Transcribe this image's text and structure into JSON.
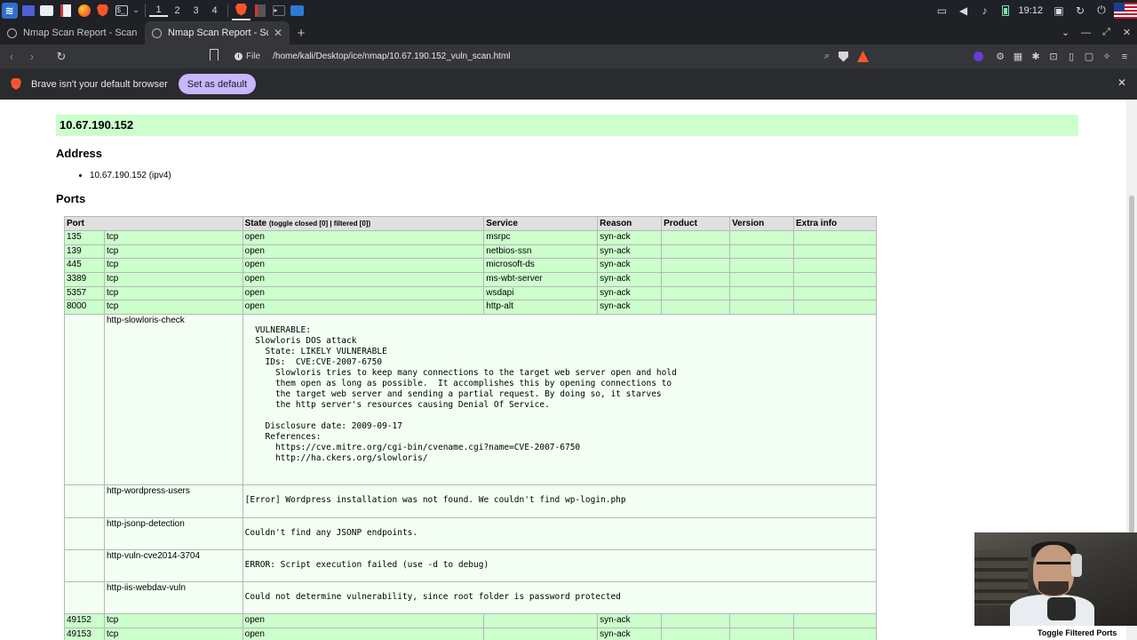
{
  "taskbar": {
    "workspaces": [
      "1",
      "2",
      "3",
      "4"
    ],
    "active_workspace": "1",
    "clock": "19:12",
    "colors": {
      "background": "#1e2127"
    }
  },
  "tabs": [
    {
      "title": "Nmap Scan Report - Scanned",
      "active": false
    },
    {
      "title": "Nmap Scan Report - Scanned",
      "active": true
    }
  ],
  "address_bar": {
    "scheme": "File",
    "path": "/home/kali/Desktop/ice/nmap/10.67.190.152_vuln_scan.html"
  },
  "infobar": {
    "message": "Brave isn't your default browser",
    "button": "Set as default"
  },
  "report": {
    "host_heading": "10.67.190.152",
    "address_heading": "Address",
    "address_item": "10.67.190.152 (ipv4)",
    "ports_heading": "Ports",
    "columns": {
      "port": "Port",
      "state": "State",
      "state_toggles": "(toggle closed [0] | filtered [0])",
      "service": "Service",
      "reason": "Reason",
      "product": "Product",
      "version": "Version",
      "extra": "Extra info"
    },
    "open_ports": [
      {
        "port": "135",
        "proto": "tcp",
        "state": "open",
        "service": "msrpc",
        "reason": "syn-ack"
      },
      {
        "port": "139",
        "proto": "tcp",
        "state": "open",
        "service": "netbios-ssn",
        "reason": "syn-ack"
      },
      {
        "port": "445",
        "proto": "tcp",
        "state": "open",
        "service": "microsoft-ds",
        "reason": "syn-ack"
      },
      {
        "port": "3389",
        "proto": "tcp",
        "state": "open",
        "service": "ms-wbt-server",
        "reason": "syn-ack"
      },
      {
        "port": "5357",
        "proto": "tcp",
        "state": "open",
        "service": "wsdapi",
        "reason": "syn-ack"
      },
      {
        "port": "8000",
        "proto": "tcp",
        "state": "open",
        "service": "http-alt",
        "reason": "syn-ack"
      }
    ],
    "scripts": [
      {
        "name": "http-slowloris-check",
        "output": "\n  VULNERABLE:\n  Slowloris DOS attack\n    State: LIKELY VULNERABLE\n    IDs:  CVE:CVE-2007-6750\n      Slowloris tries to keep many connections to the target web server open and hold\n      them open as long as possible.  It accomplishes this by opening connections to\n      the target web server and sending a partial request. By doing so, it starves\n      the http server's resources causing Denial Of Service.\n\n    Disclosure date: 2009-09-17\n    References:\n      https://cve.mitre.org/cgi-bin/cvename.cgi?name=CVE-2007-6750\n      http://ha.ckers.org/slowloris/\n"
      },
      {
        "name": "http-wordpress-users",
        "output": "[Error] Wordpress installation was not found. We couldn't find wp-login.php"
      },
      {
        "name": "http-jsonp-detection",
        "output": "Couldn't find any JSONP endpoints."
      },
      {
        "name": "http-vuln-cve2014-3704",
        "output": "ERROR: Script execution failed (use -d to debug)"
      },
      {
        "name": "http-iis-webdav-vuln",
        "output": "Could not determine vulnerability, since root folder is password protected"
      }
    ],
    "more_ports": [
      {
        "port": "49152",
        "proto": "tcp",
        "state": "open",
        "service": "",
        "reason": "syn-ack"
      },
      {
        "port": "49153",
        "proto": "tcp",
        "state": "open",
        "service": "",
        "reason": "syn-ack"
      }
    ],
    "toggle_filtered": "Toggle Filtered Ports",
    "colors": {
      "host_bar": "#ccffcc",
      "open_row": "#ccffcc",
      "script_row": "#f2fff2",
      "header_row": "#e0e0e0"
    }
  }
}
